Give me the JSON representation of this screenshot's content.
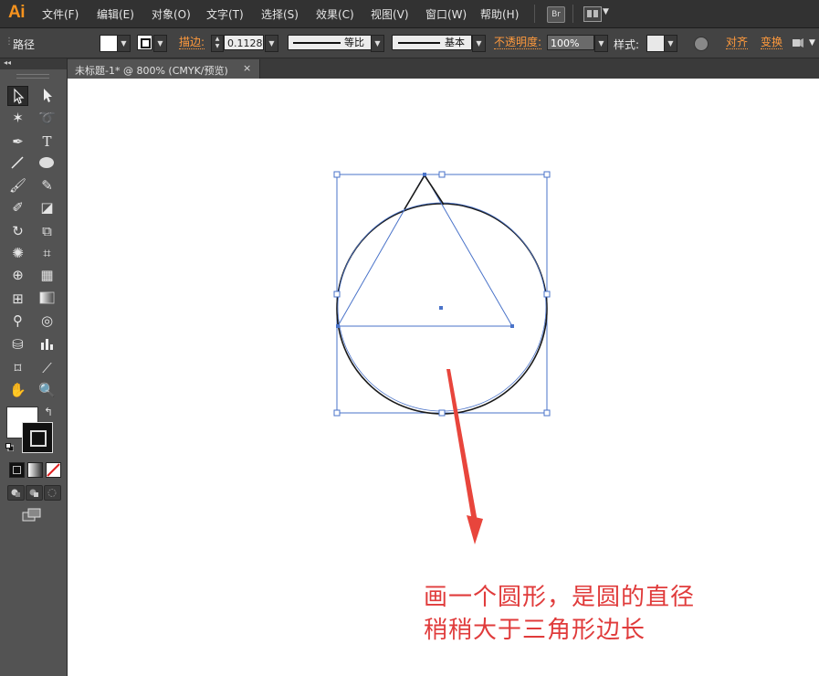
{
  "app": {
    "logo": "Ai",
    "menu": [
      "文件(F)",
      "编辑(E)",
      "对象(O)",
      "文字(T)",
      "选择(S)",
      "效果(C)",
      "视图(V)",
      "窗口(W)",
      "帮助(H)"
    ],
    "bridge_label": "Br"
  },
  "control_bar": {
    "selection_label": "路径",
    "stroke_label": "描边:",
    "stroke_weight": "0.1128",
    "stroke_profile": "等比",
    "brush": "基本",
    "opacity_label": "不透明度:",
    "opacity_value": "100%",
    "style_label": "样式:",
    "align_label": "对齐",
    "transform_label": "变换"
  },
  "document": {
    "tab_title": "未标题-1* @ 800% (CMYK/预览)",
    "close_glyph": "×"
  },
  "tools": {
    "selection": "➤",
    "direct_selection": "↖",
    "type": "T",
    "swap_glyph": "↰"
  },
  "annotation": {
    "line1": "画一个圆形，是圆的直径",
    "line2": "稍稍大于三角形边长",
    "color": "#e03b3b"
  },
  "colors": {
    "selection_blue": "#4a73c9",
    "menu_bg": "#323232",
    "panel_bg": "#535353",
    "accent_orange": "#ff9a3d"
  }
}
